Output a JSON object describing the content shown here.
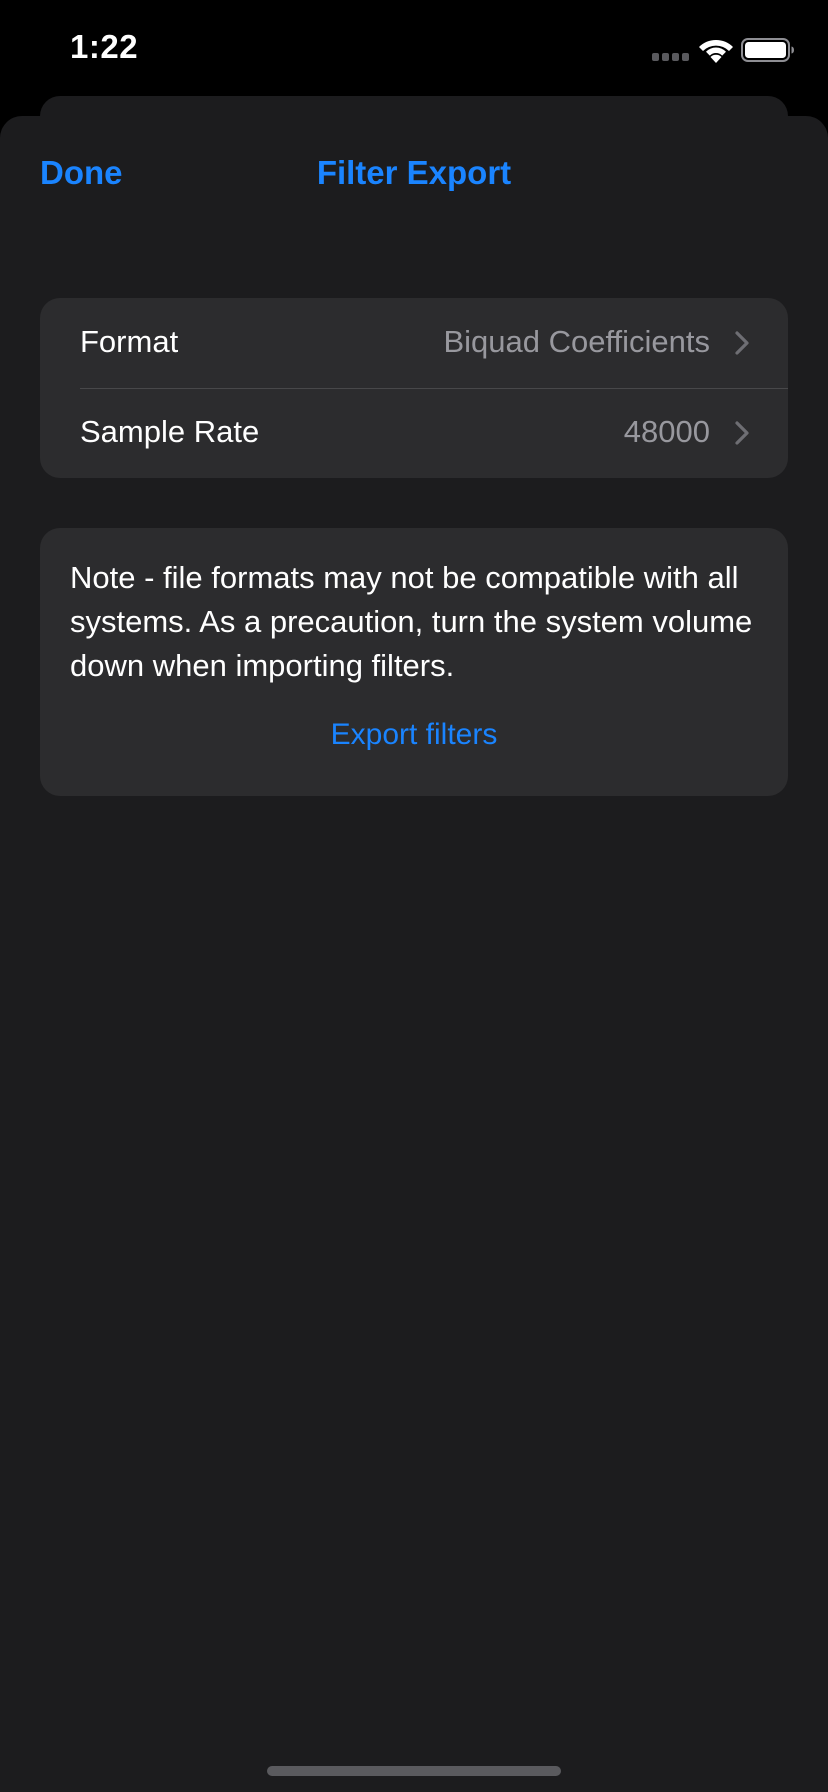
{
  "status_bar": {
    "time": "1:22",
    "signal_icon": "cellular-signal-icon",
    "wifi_icon": "wifi-icon",
    "battery_icon": "battery-icon"
  },
  "nav": {
    "done_label": "Done",
    "title": "Filter Export"
  },
  "settings": {
    "rows": [
      {
        "label": "Format",
        "value": "Biquad Coefficients",
        "icon": "chevron-right-icon"
      },
      {
        "label": "Sample Rate",
        "value": "48000",
        "icon": "chevron-right-icon"
      }
    ]
  },
  "note": {
    "text": "Note - file formats may not be compatible with all systems. As a precaution, turn the system volume down when importing filters.",
    "export_label": "Export filters"
  },
  "colors": {
    "accent": "#1a84ff",
    "background": "#1c1c1e",
    "card": "#2c2c2e",
    "secondary_text": "#98989e"
  }
}
